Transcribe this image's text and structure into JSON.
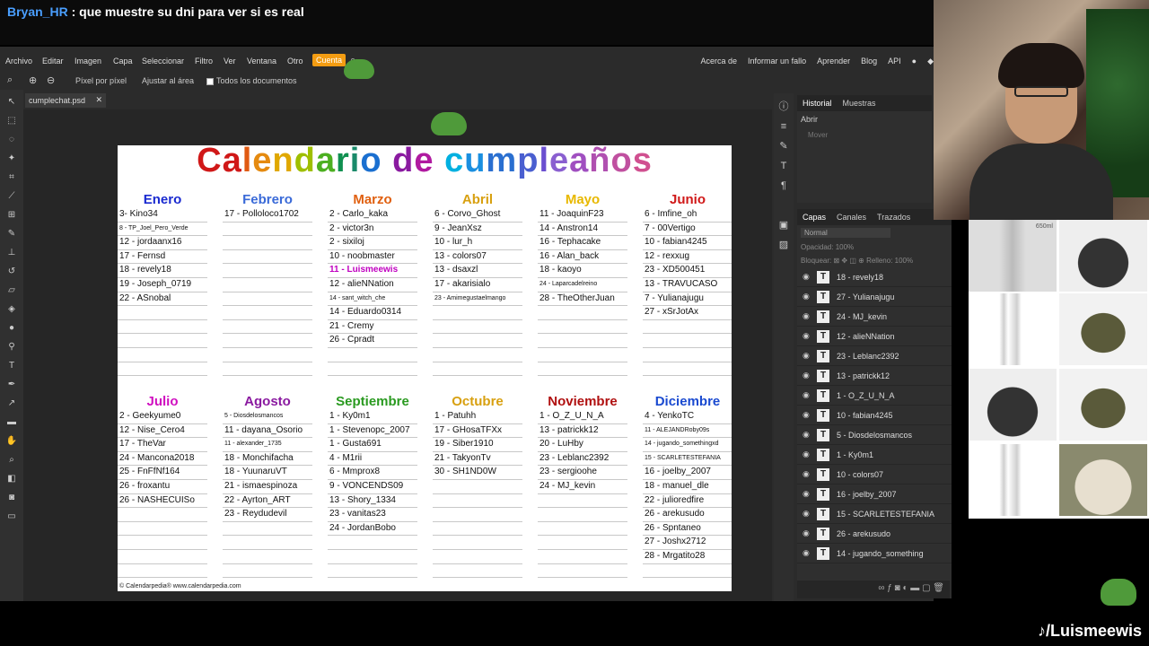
{
  "chat": {
    "user": "Bryan_HR",
    "message": ": que muestre su dni para ver si es real"
  },
  "menu": {
    "left": [
      "Archivo",
      "Editar",
      "Imagen",
      "Capa",
      "Seleccionar",
      "Filtro",
      "Ver",
      "Ventana",
      "Otro",
      "Cuenta"
    ],
    "right": [
      "Acerca de",
      "Informar un fallo",
      "Aprender",
      "Blog",
      "API"
    ]
  },
  "options": {
    "pixel": "Píxel por píxel",
    "fit": "Ajustar al área",
    "all_docs": "Todos los documentos"
  },
  "document_tab": "cumplechat.psd",
  "calendar": {
    "title_letters": [
      "C",
      "a",
      "l",
      "e",
      "n",
      "d",
      "a",
      "r",
      "i",
      "o",
      " ",
      "d",
      "e",
      " ",
      "c",
      "u",
      "m",
      "p",
      "l",
      "e",
      "a",
      "ñ",
      "o",
      "s"
    ],
    "title_colors": [
      "#d01818",
      "#d01818",
      "#e05a12",
      "#e58a10",
      "#e0a800",
      "#9fbf00",
      "#4caf20",
      "#109050",
      "#1a8a6a",
      "#1a6fd0",
      "#000000",
      "#8a1aa0",
      "#b01aa0",
      "#000000",
      "#00b0e0",
      "#1a8fe0",
      "#2a6fd0",
      "#4a5fd0",
      "#6a4fd0",
      "#8a5fd0",
      "#a04fc0",
      "#b050b0",
      "#c050a0",
      "#d05090"
    ],
    "months": [
      {
        "name": "Enero",
        "color": "#1a2ad0",
        "entries": [
          "3- Kino34",
          "8 - TP_Joel_Pero_Verde",
          "12 - jordaanx16",
          "17 - Fernsd",
          "18 - revely18",
          "19 - Joseph_0719",
          "22 - ASnobal"
        ]
      },
      {
        "name": "Febrero",
        "color": "#3a6ad8",
        "entries": [
          "17 - Polloloco1702"
        ]
      },
      {
        "name": "Marzo",
        "color": "#e06010",
        "entries": [
          "2 - Carlo_kaka",
          "2 - victor3n",
          "2 - sixiloj",
          "10 - noobmaster",
          "11 - Luismeewis",
          "12 - alieNNation",
          "14 - sant_witch_che",
          "14 - Eduardo0314",
          "21 - Cremy",
          "26 - Cpradt"
        ]
      },
      {
        "name": "Abril",
        "color": "#d8a010",
        "entries": [
          "6 - Corvo_Ghost",
          "9 - JeanXsz",
          "10 - lur_h",
          "13 - colors07",
          "13 - dsaxzl",
          "17 - akarisialo",
          "23 - Amimegustaelmango"
        ]
      },
      {
        "name": "Mayo",
        "color": "#e8b800",
        "entries": [
          "11 - JoaquinF23",
          "14 - Anstron14",
          "16 - Tephacake",
          "16 - Alan_back",
          "18 - kaoyo",
          "24 - Laparcadelreino",
          "28 - TheOtherJuan"
        ]
      },
      {
        "name": "Junio",
        "color": "#d01818",
        "entries": [
          "6 - Imfine_oh",
          "7 - 00Vertigo",
          "10 - fabian4245",
          "12 - rexxug",
          "23 - XD500451",
          "13 - TRAVUCASO",
          "7 - Yulianajugu",
          "27 - xSrJotAx"
        ]
      },
      {
        "name": "Julio",
        "color": "#d010c0",
        "entries": [
          "2 - Geekyume0",
          "12 - Nise_Cero4",
          "17 - TheVar",
          "24 - Mancona2018",
          "25 - FnFfNf164",
          "26 - froxantu",
          "26 - NASHECUISo"
        ]
      },
      {
        "name": "Agosto",
        "color": "#8a1aa0",
        "entries": [
          "5 - Diosdelosmancos",
          "11 - dayana_Osorio",
          "11 - alexander_1735",
          "18 - Monchifacha",
          "18 - YuunaruVT",
          "21 - ismaespinoza",
          "22 - Ayrton_ART",
          "23 - Reydudevil"
        ]
      },
      {
        "name": "Septiembre",
        "color": "#2a9a20",
        "entries": [
          "1 - Ky0m1",
          "1 - Stevenopc_2007",
          "1 - Gusta691",
          "4 - M1rii",
          "6 - Mmprox8",
          "9 - VONCENDS09",
          "13 - Shory_1334",
          "23 - vanitas23",
          "24 - JordanBobo"
        ]
      },
      {
        "name": "Octubre",
        "color": "#d8a010",
        "entries": [
          "1 - Patuhh",
          "17 - GHosaTFXx",
          "19 - Siber1910",
          "21 - TakyonTv",
          "30 - SH1ND0W"
        ]
      },
      {
        "name": "Noviembre",
        "color": "#b01010",
        "entries": [
          "1 - O_Z_U_N_A",
          "13 - patrickk12",
          "20 - LuHby",
          "23 - Leblanc2392",
          "23 - sergioohe",
          "24 - MJ_kevin"
        ]
      },
      {
        "name": "Diciembre",
        "color": "#1a4ad0",
        "entries": [
          "4 - YenkoTC",
          "11 - ALEJANDRoby09s",
          "14 - jugando_somethingxd",
          "15 - SCARLETESTEFANIA",
          "16 - joelby_2007",
          "18 - manuel_dle",
          "22 - julioredfire",
          "26 - arekusudo",
          "26 - Spntaneo",
          "27 - Joshx2712",
          "28 - Mrgatito28"
        ]
      }
    ],
    "footer": "© Calendarpedia®  www.calendarpedia.com"
  },
  "history_panel": {
    "tabs": [
      "Historial",
      "Muestras"
    ],
    "items": [
      "Abrir",
      "Mover"
    ]
  },
  "layers_panel": {
    "tabs": [
      "Capas",
      "Canales",
      "Trazados"
    ],
    "blend": "Normal",
    "opacity_label": "Opacidad:",
    "opacity": "100%",
    "lock_label": "Bloquear:",
    "fill_label": "Relleno:",
    "fill": "100%",
    "layers": [
      "18 - revely18",
      "27 - Yulianajugu",
      "24 - MJ_kevin",
      "12 - alieNNation",
      "23 - Leblanc2392",
      "13 - patrickk12",
      "1 - O_Z_U_N_A",
      "10 - fabian4245",
      "5 - Diosdelosmancos",
      "1 - Ky0m1",
      "10 - colors07",
      "16 - joelby_2007",
      "15 - SCARLETESTEFANIA",
      "26 - arekusudo",
      "14 - jugando_something"
    ]
  },
  "products": {
    "bottle_label": "650ml"
  },
  "watermark": "/Luismeewis"
}
